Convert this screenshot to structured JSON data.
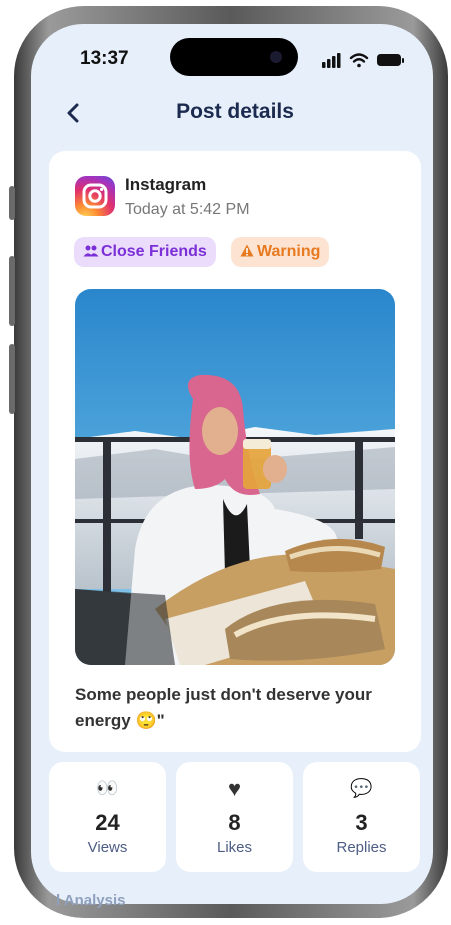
{
  "status_bar": {
    "time": "13:37"
  },
  "header": {
    "title": "Post details"
  },
  "post": {
    "platform": "Instagram",
    "timestamp": "Today at 5:42 PM",
    "tags": [
      {
        "label": "Close Friends",
        "icon": "people-icon",
        "color": "#7b2fd6"
      },
      {
        "label": "Warning",
        "icon": "warning-icon",
        "color": "#e77a20"
      }
    ],
    "photo_alt": "photo",
    "caption": "Some people just don't deserve your energy 🙄\""
  },
  "stats": [
    {
      "icon": "eyes-icon",
      "glyph": "👀",
      "value": "24",
      "label": "Views"
    },
    {
      "icon": "heart-icon",
      "glyph": "♥",
      "value": "8",
      "label": "Likes"
    },
    {
      "icon": "speech-bubble-icon",
      "glyph": "💬",
      "value": "3",
      "label": "Replies"
    }
  ],
  "section": {
    "partial_label": "l Analysis"
  },
  "colors": {
    "background": "#e6effa",
    "title": "#1b2a4e"
  }
}
